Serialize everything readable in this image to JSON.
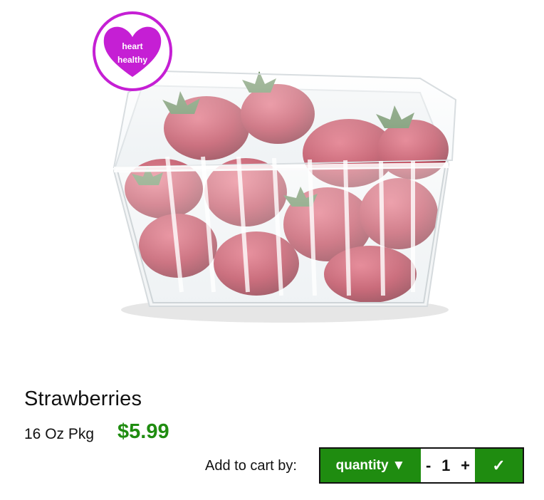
{
  "product": {
    "image_alt": "Strawberries in clear clamshell container",
    "badge": {
      "line1": "heart",
      "line2": "healthy",
      "color": "#c51fd4",
      "icon": "heart-icon"
    },
    "name": "Strawberries",
    "size": "16 Oz Pkg",
    "price": "$5.99",
    "price_color": "#1f8c10"
  },
  "cart": {
    "label": "Add to cart by:",
    "mode": "quantity",
    "mode_icon": "triangle-down-icon",
    "mode_arrow": "▼",
    "decrement": "-",
    "quantity": "1",
    "increment": "+",
    "confirm": "✓",
    "accent_color": "#1f8c10"
  }
}
